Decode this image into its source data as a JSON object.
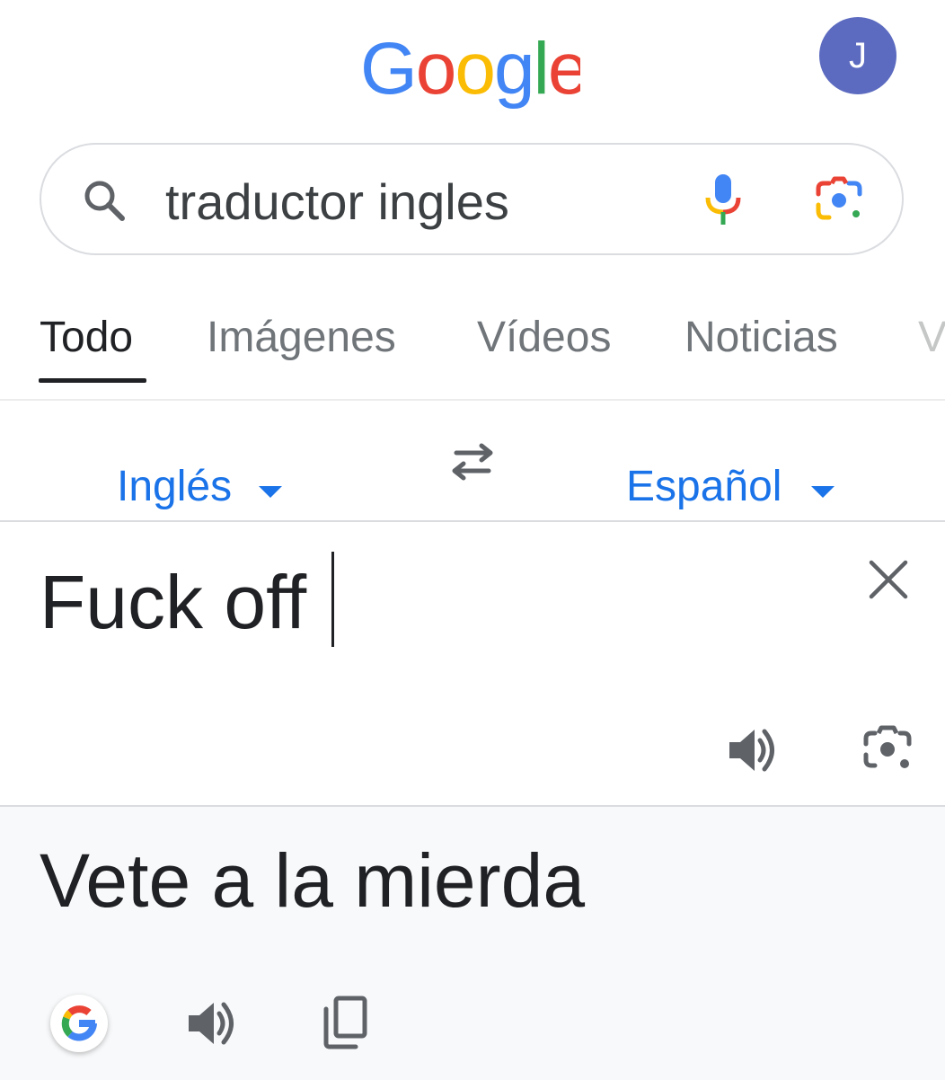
{
  "header": {
    "logo_text": "Google",
    "avatar_initial": "J"
  },
  "search": {
    "query": "traductor ingles"
  },
  "tabs": [
    {
      "label": "Todo",
      "active": true
    },
    {
      "label": "Imágenes",
      "active": false
    },
    {
      "label": "Vídeos",
      "active": false
    },
    {
      "label": "Noticias",
      "active": false
    },
    {
      "label": "V",
      "active": false
    }
  ],
  "translator": {
    "source_language": "Inglés",
    "target_language": "Español",
    "source_text": "Fuck off",
    "translated_text": "Vete a la mierda"
  },
  "colors": {
    "google_blue": "#4285F4",
    "google_red": "#EA4335",
    "google_yellow": "#FBBC05",
    "google_green": "#34A853",
    "link_blue": "#1a73e8",
    "avatar_bg": "#5c6bc0"
  },
  "icons": {
    "search": "search-icon",
    "mic": "mic-icon",
    "lens": "google-lens-icon",
    "swap": "swap-icon",
    "close": "close-icon",
    "speaker": "speaker-icon",
    "camera": "camera-icon",
    "google_g": "google-g-icon",
    "copy": "copy-icon"
  }
}
